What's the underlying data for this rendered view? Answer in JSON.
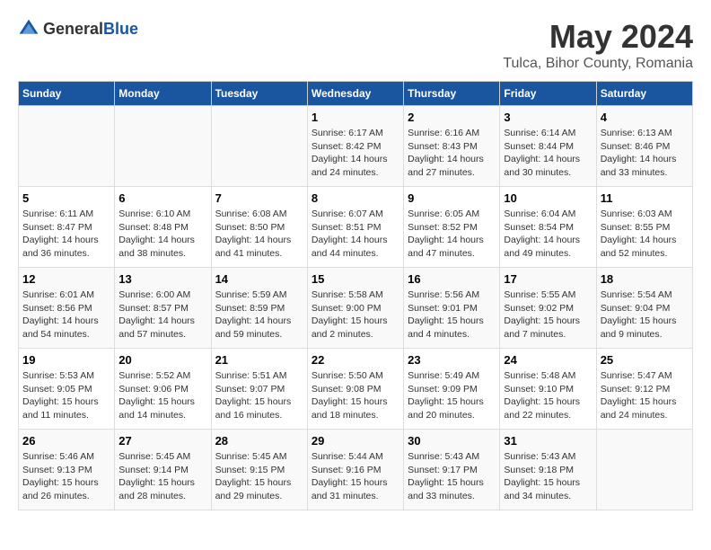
{
  "header": {
    "logo_general": "General",
    "logo_blue": "Blue",
    "title": "May 2024",
    "subtitle": "Tulca, Bihor County, Romania"
  },
  "days_of_week": [
    "Sunday",
    "Monday",
    "Tuesday",
    "Wednesday",
    "Thursday",
    "Friday",
    "Saturday"
  ],
  "weeks": [
    [
      {
        "day": "",
        "info": ""
      },
      {
        "day": "",
        "info": ""
      },
      {
        "day": "",
        "info": ""
      },
      {
        "day": "1",
        "info": "Sunrise: 6:17 AM\nSunset: 8:42 PM\nDaylight: 14 hours\nand 24 minutes."
      },
      {
        "day": "2",
        "info": "Sunrise: 6:16 AM\nSunset: 8:43 PM\nDaylight: 14 hours\nand 27 minutes."
      },
      {
        "day": "3",
        "info": "Sunrise: 6:14 AM\nSunset: 8:44 PM\nDaylight: 14 hours\nand 30 minutes."
      },
      {
        "day": "4",
        "info": "Sunrise: 6:13 AM\nSunset: 8:46 PM\nDaylight: 14 hours\nand 33 minutes."
      }
    ],
    [
      {
        "day": "5",
        "info": "Sunrise: 6:11 AM\nSunset: 8:47 PM\nDaylight: 14 hours\nand 36 minutes."
      },
      {
        "day": "6",
        "info": "Sunrise: 6:10 AM\nSunset: 8:48 PM\nDaylight: 14 hours\nand 38 minutes."
      },
      {
        "day": "7",
        "info": "Sunrise: 6:08 AM\nSunset: 8:50 PM\nDaylight: 14 hours\nand 41 minutes."
      },
      {
        "day": "8",
        "info": "Sunrise: 6:07 AM\nSunset: 8:51 PM\nDaylight: 14 hours\nand 44 minutes."
      },
      {
        "day": "9",
        "info": "Sunrise: 6:05 AM\nSunset: 8:52 PM\nDaylight: 14 hours\nand 47 minutes."
      },
      {
        "day": "10",
        "info": "Sunrise: 6:04 AM\nSunset: 8:54 PM\nDaylight: 14 hours\nand 49 minutes."
      },
      {
        "day": "11",
        "info": "Sunrise: 6:03 AM\nSunset: 8:55 PM\nDaylight: 14 hours\nand 52 minutes."
      }
    ],
    [
      {
        "day": "12",
        "info": "Sunrise: 6:01 AM\nSunset: 8:56 PM\nDaylight: 14 hours\nand 54 minutes."
      },
      {
        "day": "13",
        "info": "Sunrise: 6:00 AM\nSunset: 8:57 PM\nDaylight: 14 hours\nand 57 minutes."
      },
      {
        "day": "14",
        "info": "Sunrise: 5:59 AM\nSunset: 8:59 PM\nDaylight: 14 hours\nand 59 minutes."
      },
      {
        "day": "15",
        "info": "Sunrise: 5:58 AM\nSunset: 9:00 PM\nDaylight: 15 hours\nand 2 minutes."
      },
      {
        "day": "16",
        "info": "Sunrise: 5:56 AM\nSunset: 9:01 PM\nDaylight: 15 hours\nand 4 minutes."
      },
      {
        "day": "17",
        "info": "Sunrise: 5:55 AM\nSunset: 9:02 PM\nDaylight: 15 hours\nand 7 minutes."
      },
      {
        "day": "18",
        "info": "Sunrise: 5:54 AM\nSunset: 9:04 PM\nDaylight: 15 hours\nand 9 minutes."
      }
    ],
    [
      {
        "day": "19",
        "info": "Sunrise: 5:53 AM\nSunset: 9:05 PM\nDaylight: 15 hours\nand 11 minutes."
      },
      {
        "day": "20",
        "info": "Sunrise: 5:52 AM\nSunset: 9:06 PM\nDaylight: 15 hours\nand 14 minutes."
      },
      {
        "day": "21",
        "info": "Sunrise: 5:51 AM\nSunset: 9:07 PM\nDaylight: 15 hours\nand 16 minutes."
      },
      {
        "day": "22",
        "info": "Sunrise: 5:50 AM\nSunset: 9:08 PM\nDaylight: 15 hours\nand 18 minutes."
      },
      {
        "day": "23",
        "info": "Sunrise: 5:49 AM\nSunset: 9:09 PM\nDaylight: 15 hours\nand 20 minutes."
      },
      {
        "day": "24",
        "info": "Sunrise: 5:48 AM\nSunset: 9:10 PM\nDaylight: 15 hours\nand 22 minutes."
      },
      {
        "day": "25",
        "info": "Sunrise: 5:47 AM\nSunset: 9:12 PM\nDaylight: 15 hours\nand 24 minutes."
      }
    ],
    [
      {
        "day": "26",
        "info": "Sunrise: 5:46 AM\nSunset: 9:13 PM\nDaylight: 15 hours\nand 26 minutes."
      },
      {
        "day": "27",
        "info": "Sunrise: 5:45 AM\nSunset: 9:14 PM\nDaylight: 15 hours\nand 28 minutes."
      },
      {
        "day": "28",
        "info": "Sunrise: 5:45 AM\nSunset: 9:15 PM\nDaylight: 15 hours\nand 29 minutes."
      },
      {
        "day": "29",
        "info": "Sunrise: 5:44 AM\nSunset: 9:16 PM\nDaylight: 15 hours\nand 31 minutes."
      },
      {
        "day": "30",
        "info": "Sunrise: 5:43 AM\nSunset: 9:17 PM\nDaylight: 15 hours\nand 33 minutes."
      },
      {
        "day": "31",
        "info": "Sunrise: 5:43 AM\nSunset: 9:18 PM\nDaylight: 15 hours\nand 34 minutes."
      },
      {
        "day": "",
        "info": ""
      }
    ]
  ]
}
